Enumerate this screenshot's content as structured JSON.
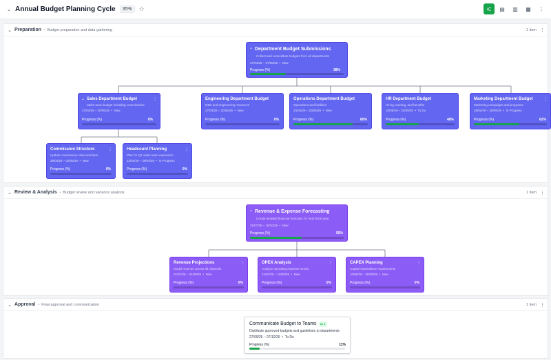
{
  "header": {
    "title": "Annual Budget Planning Cycle",
    "progress": "35%",
    "icons": [
      "chevron-down-icon",
      "star-icon",
      "tree-view-icon",
      "calendar-icon",
      "board-icon",
      "table-icon",
      "more-icon"
    ]
  },
  "sections": [
    {
      "name": "Preparation",
      "desc": "Budget preparation and data gathering",
      "count": "1 item",
      "root": {
        "title": "Department Budget Submissions",
        "desc": "Collect and consolidate budgets from all departments",
        "dates": "27/04/26 – 27/05/26",
        "status": "New",
        "progress_label": "Progress (%)",
        "progress": 38,
        "progress_text": "38%"
      },
      "children": [
        {
          "title": "Sales Department Budget",
          "desc": "Sales team budget including commissions",
          "dates": "27/04/26 – 20/05/26",
          "status": "New",
          "progress_label": "Progress (%)",
          "progress": 0,
          "progress_text": "0%"
        },
        {
          "title": "Engineering Department Budget",
          "desc": "R&D and engineering resources",
          "dates": "27/04/26 – 20/05/26",
          "status": "New",
          "progress_label": "Progress (%)",
          "progress": 0,
          "progress_text": "0%"
        },
        {
          "title": "Operations Department Budget",
          "desc": "Operations and facilities",
          "dates": "24/04/26 – 20/05/26",
          "status": "New",
          "progress_label": "Progress (%)",
          "progress": 80,
          "progress_text": "80%"
        },
        {
          "title": "HR Department Budget",
          "desc": "Hiring, training, and benefits",
          "dates": "10/05/26 – 23/05/26",
          "status": "To Do",
          "progress_label": "Progress (%)",
          "progress": 48,
          "progress_text": "48%"
        },
        {
          "title": "Marketing Department Budget",
          "desc": "Marketing campaigns and programs",
          "dates": "28/04/26 – 28/05/26",
          "status": "In Progress",
          "progress_label": "Progress (%)",
          "progress": 62,
          "progress_text": "62%"
        }
      ],
      "grandchildren": [
        {
          "title": "Commission Structure",
          "desc": "Update commission rates and tiers",
          "dates": "28/04/26 – 02/05/26",
          "status": "New",
          "progress_label": "Progress (%)",
          "progress": 0,
          "progress_text": "0%"
        },
        {
          "title": "Headcount Planning",
          "desc": "Plan for Q1 sales team expansion",
          "dates": "23/04/26 – 29/04/26",
          "status": "In Progress",
          "progress_label": "Progress (%)",
          "progress": 0,
          "progress_text": "0%"
        }
      ]
    },
    {
      "name": "Review & Analysis",
      "desc": "Budget review and variance analysis",
      "count": "1 item",
      "root": {
        "title": "Revenue & Expense Forecasting",
        "desc": "Create detailed financial forecasts for next fiscal year",
        "dates": "21/07/26 – 10/10/26",
        "status": "New",
        "progress_label": "Progress (%)",
        "progress": 55,
        "progress_text": "55%"
      },
      "children": [
        {
          "title": "Revenue Projections",
          "desc": "Model revenue across all channels",
          "dates": "21/07/26 – 31/08/26",
          "status": "New",
          "progress_label": "Progress (%)",
          "progress": 0,
          "progress_text": "0%"
        },
        {
          "title": "OPEX Analysis",
          "desc": "Analyze operating expense trends",
          "dates": "21/07/26 – 10/09/26",
          "status": "New",
          "progress_label": "Progress (%)",
          "progress": 0,
          "progress_text": "0%"
        },
        {
          "title": "CAPEX Planning",
          "desc": "Capital expenditure requirements",
          "dates": "10/08/26 – 20/09/26",
          "status": "New",
          "progress_label": "Progress (%)",
          "progress": 0,
          "progress_text": "0%"
        }
      ]
    },
    {
      "name": "Approval",
      "desc": "Final approval and communication",
      "count": "1 item",
      "root": {
        "title": "Communicate Budget to Teams",
        "badge": "⇄ 2",
        "desc": "Distribute approved budgets and guidelines to departments",
        "dates": "27/09/26 – 07/10/26",
        "status": "To Do",
        "progress_label": "Progress (%)",
        "progress": 11,
        "progress_text": "11%"
      }
    }
  ]
}
